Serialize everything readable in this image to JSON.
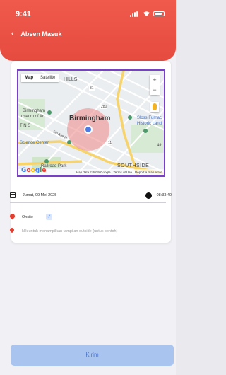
{
  "status_bar": {
    "time": "9:41"
  },
  "header": {
    "back_icon": "chevron-left-icon",
    "title": "Absen Masuk"
  },
  "map": {
    "tab_map": "Map",
    "tab_satellite": "Satellite",
    "zoom_in": "+",
    "zoom_out": "−",
    "labels": {
      "hills": "HILLS",
      "museum_1": "Birmingham",
      "museum_2": "useum of Art",
      "city": "Birmingham",
      "sloss_1": "Sloss Furnac",
      "sloss_2": "Historic Land",
      "science": "Science Center",
      "southside": "SOUTHSIDE",
      "park": "Railroad Park",
      "ave": "5th Ave N",
      "fourth": "4th",
      "route_280": "280",
      "route_11": "11",
      "route_31": "31",
      "n_letters": "T N S"
    },
    "logo": "Google",
    "footer": {
      "copyright": "Map data ©2019 Google",
      "terms": "Terms of Use",
      "report": "Report a map error"
    }
  },
  "info": {
    "date": "Jumat, 09 Mei 2025",
    "time": "08:33:40",
    "onsite_label": "Onsite",
    "onsite_checked": true,
    "hint": "klik untuk menampilkan tampilan outside (untuk contoh)"
  },
  "submit_button": {
    "label": "Kirim"
  },
  "colors": {
    "header": "#e64b3f",
    "map_border": "#7a3fc9",
    "button": "#a9c4ef",
    "pin": "#e23d2f"
  }
}
